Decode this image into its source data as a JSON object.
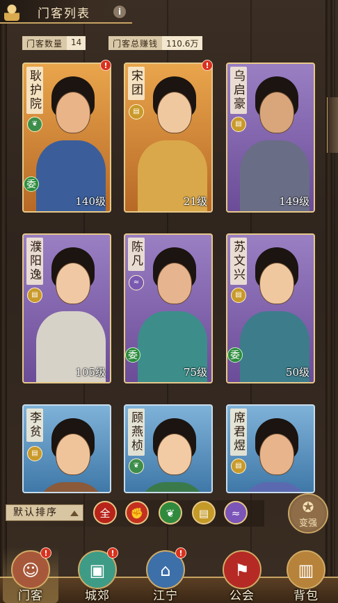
{
  "header": {
    "title": "门客列表",
    "info_icon": "i"
  },
  "stats": {
    "count_label": "门客数量",
    "count_value": "14",
    "earnings_label": "门客总赚钱",
    "earnings_value": "110.6万"
  },
  "cards": [
    {
      "name": "耿护院",
      "level": "140级",
      "color": "orange",
      "type_icon": "leaf-icon",
      "type_symbol": "❦",
      "type_color": "#3d8e4a",
      "has_badge": true,
      "wei": "委"
    },
    {
      "name": "宋团",
      "level": "21级",
      "color": "orange",
      "type_icon": "scroll-icon",
      "type_symbol": "▤",
      "type_color": "#c99a2b",
      "has_badge": true,
      "wei": ""
    },
    {
      "name": "乌启豪",
      "level": "149级",
      "color": "purple",
      "type_icon": "scroll-icon",
      "type_symbol": "▤",
      "type_color": "#c99a2b",
      "has_badge": false,
      "wei": ""
    },
    {
      "name": "濮阳逸",
      "level": "105级",
      "color": "purple",
      "type_icon": "scroll-icon",
      "type_symbol": "▤",
      "type_color": "#c99a2b",
      "has_badge": false,
      "wei": ""
    },
    {
      "name": "陈凡",
      "level": "75级",
      "color": "purple",
      "type_icon": "wave-icon",
      "type_symbol": "≈",
      "type_color": "#7a5ab0",
      "has_badge": false,
      "wei": "委"
    },
    {
      "name": "苏文兴",
      "level": "50级",
      "color": "purple",
      "type_icon": "scroll-icon",
      "type_symbol": "▤",
      "type_color": "#c99a2b",
      "has_badge": false,
      "wei": "委"
    },
    {
      "name": "李贫",
      "level": "",
      "color": "blue",
      "type_icon": "scroll-icon",
      "type_symbol": "▤",
      "type_color": "#c99a2b",
      "has_badge": false,
      "wei": ""
    },
    {
      "name": "顾燕桢",
      "level": "",
      "color": "blue",
      "type_icon": "leaf-icon",
      "type_symbol": "❦",
      "type_color": "#3d8e4a",
      "has_badge": false,
      "wei": ""
    },
    {
      "name": "席君煜",
      "level": "",
      "color": "blue",
      "type_icon": "scroll-icon",
      "type_symbol": "▤",
      "type_color": "#c99a2b",
      "has_badge": false,
      "wei": ""
    }
  ],
  "sort": {
    "label": "默认排序"
  },
  "filters": [
    {
      "key": "all",
      "text": "全",
      "bg": "#b8231a"
    },
    {
      "key": "strength",
      "text": "✊",
      "bg": "#c43020"
    },
    {
      "key": "leaf",
      "text": "❦",
      "bg": "#2f8a3e"
    },
    {
      "key": "scroll",
      "text": "▤",
      "bg": "#c49a28"
    },
    {
      "key": "wave",
      "text": "≈",
      "bg": "#7b55b8"
    }
  ],
  "strong_button": {
    "label": "变强",
    "icon": "muscle-icon"
  },
  "nav": [
    {
      "label": "门客",
      "icon": "retainer-icon",
      "symbol": "☺",
      "bg": "#a8583a",
      "badge": true,
      "active": true
    },
    {
      "label": "城郊",
      "icon": "bus-icon",
      "symbol": "▣",
      "bg": "#3e9b86",
      "badge": true,
      "active": false
    },
    {
      "label": "江宁",
      "icon": "palace-icon",
      "symbol": "⌂",
      "bg": "#3d6fa8",
      "badge": true,
      "active": false
    },
    {
      "label": "公会",
      "icon": "banner-icon",
      "symbol": "⚑",
      "bg": "#b52a24",
      "badge": false,
      "active": false
    },
    {
      "label": "背包",
      "icon": "backpack-icon",
      "symbol": "▥",
      "bg": "#b7823a",
      "badge": false,
      "active": false
    }
  ],
  "badge_text": "!"
}
